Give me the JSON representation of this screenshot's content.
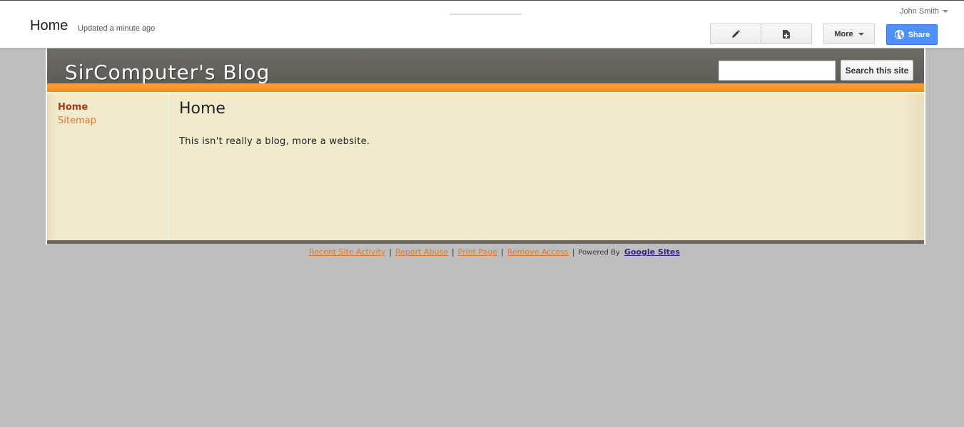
{
  "topbar": {
    "page_title": "Home",
    "updated": "Updated a minute ago",
    "user": "John Smith",
    "more_label": "More",
    "share_label": "Share"
  },
  "site": {
    "title": "SirComputer's Blog",
    "search_button": "Search this site",
    "search_value": ""
  },
  "sidebar": {
    "items": [
      {
        "label": "Home"
      },
      {
        "label": "Sitemap"
      }
    ]
  },
  "main": {
    "title": "Home",
    "text": "This isn't really a blog, more a website."
  },
  "footer": {
    "links": [
      "Recent Site Activity",
      "Report Abuse",
      "Print Page",
      "Remove Access"
    ],
    "separator": "|",
    "powered_by": "Powered By",
    "google_sites": "Google Sites"
  },
  "colors": {
    "accent_orange": "#f38a1a",
    "share_blue": "#4d90fe",
    "content_bg": "#f0ebcd",
    "header_gray": "#6e6b66"
  },
  "icons": {
    "edit": "pencil-icon",
    "new_page": "new-page-icon",
    "share": "globe-icon"
  }
}
